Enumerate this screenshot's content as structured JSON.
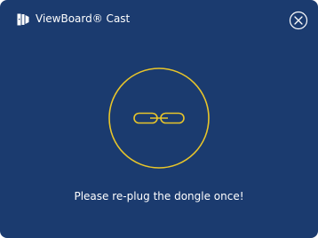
{
  "window": {
    "title": "ViewBoard® Cast",
    "app_icon": "viewboard-cast-icon",
    "close_icon": "close-circle-icon"
  },
  "main": {
    "status_icon": "chain-link-icon",
    "message": "Please re-plug the dongle once!"
  },
  "colors": {
    "background": "#1b3b6f",
    "accent": "#e8c52a",
    "text": "#ffffff"
  }
}
